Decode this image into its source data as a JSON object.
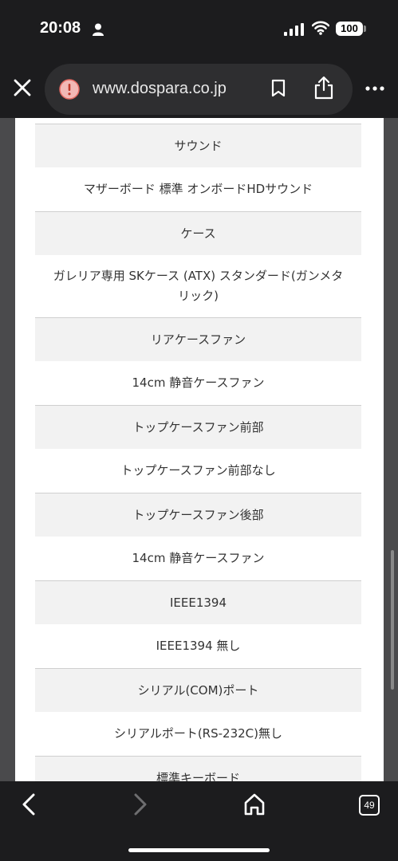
{
  "status_bar": {
    "time": "20:08",
    "battery": "100"
  },
  "browser": {
    "url": "www.dospara.co.jp",
    "tab_count": "49"
  },
  "spec_rows": [
    {
      "label": "サウンド",
      "value": "マザーボード 標準 オンボードHDサウンド"
    },
    {
      "label": "ケース",
      "value": "ガレリア専用 SKケース (ATX) スタンダード(ガンメタリック)"
    },
    {
      "label": "リアケースファン",
      "value": "14cm 静音ケースファン"
    },
    {
      "label": "トップケースファン前部",
      "value": "トップケースファン前部なし"
    },
    {
      "label": "トップケースファン後部",
      "value": "14cm 静音ケースファン"
    },
    {
      "label": "IEEE1394",
      "value": "IEEE1394 無し"
    },
    {
      "label": "シリアル(COM)ポート",
      "value": "シリアルポート(RS-232C)無し"
    },
    {
      "label": "標準キーボード",
      "value": ""
    }
  ]
}
